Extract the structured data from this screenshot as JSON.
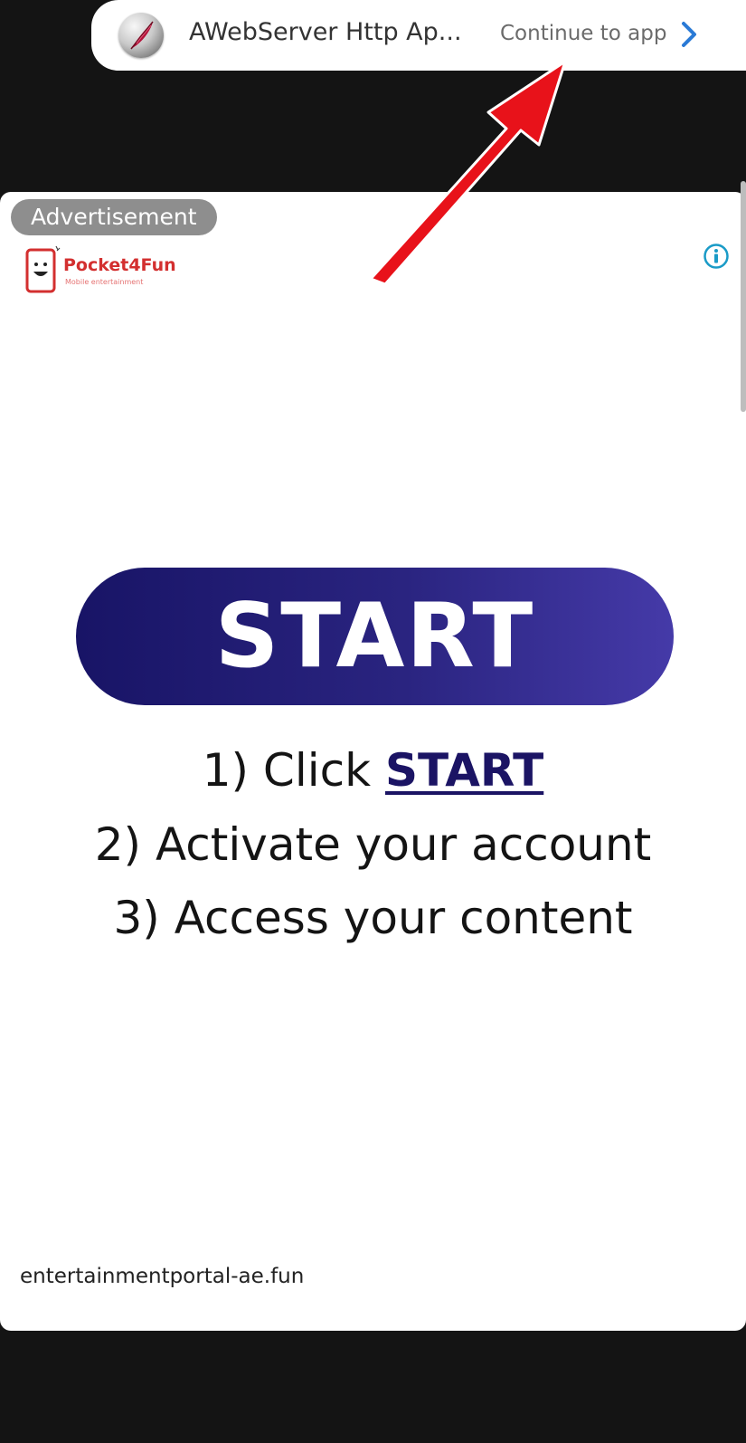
{
  "app_bar": {
    "app_name": "AWebServer Http Ap...",
    "continue_label": "Continue to app",
    "icon": "feather-app-icon",
    "chevron_icon": "chevron-right-icon",
    "chevron_color": "#2a7ad6"
  },
  "ad": {
    "badge_label": "Advertisement",
    "info_icon": "info-icon",
    "info_color": "#1a9bc7",
    "brand": {
      "name": "Pocket4Fun",
      "tagline": "Mobile entertainment",
      "color": "#d32f2f"
    },
    "start_button_label": "START",
    "steps": {
      "step1_prefix": "1) Click ",
      "step1_link": "START",
      "step2": "2) Activate your account",
      "step3": "3) Access your content"
    },
    "domain": "entertainmentportal-ae.fun"
  },
  "colors": {
    "background": "#141414",
    "button_gradient_start": "#181466",
    "button_gradient_end": "#453aa8",
    "annotation_arrow": "#e8121a"
  }
}
